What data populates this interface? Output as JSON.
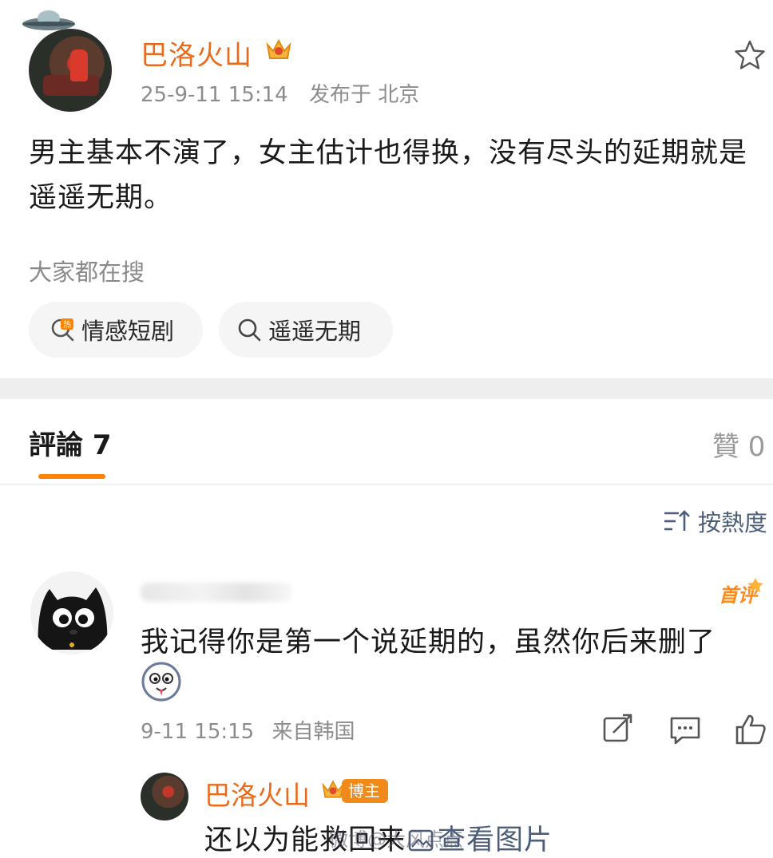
{
  "post": {
    "author_name": "巴洛火山",
    "timestamp": "25-9-11 15:14",
    "location": "发布于 北京",
    "body": "男主基本不演了，女主估计也得换，没有尽头的延期就是遥遥无期。",
    "search_section_label": "大家都在搜",
    "search_chips": [
      {
        "label": "情感短剧",
        "icon": "hot-search-icon"
      },
      {
        "label": "遥遥无期",
        "icon": "search-icon"
      }
    ]
  },
  "comments_header": {
    "tab_label": "評論 7",
    "likes_label": "贊 0",
    "sort_label": "按熱度",
    "accent_color": "#ff8200"
  },
  "comment": {
    "badge": "首评",
    "text": "我记得你是第一个说延期的，虽然你后来删了",
    "time": "9-11 15:15",
    "source": "来自韩国"
  },
  "reply": {
    "author_name": "巴洛火山",
    "author_badge": "博主",
    "text": "还以为能救回来",
    "view_image_label": "查看图片"
  },
  "watermark": "微博@大风点点",
  "colors": {
    "author_orange": "#ea6a1a",
    "meta_gray": "#8c8c8c",
    "link_blue": "#4b5d78",
    "divider": "#eeeeee"
  }
}
